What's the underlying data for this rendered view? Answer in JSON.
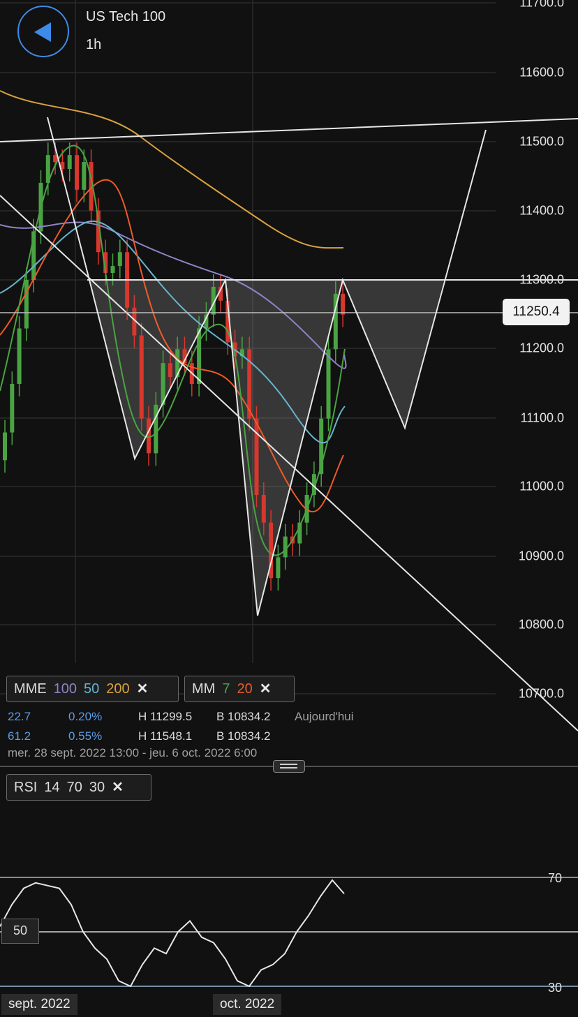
{
  "header": {
    "back_icon": "back-arrow-icon",
    "symbol": "US Tech 100",
    "timeframe": "1h"
  },
  "price_axis": {
    "labels": [
      "11700.0",
      "11600.0",
      "11500.0",
      "11400.0",
      "11300.0",
      "11200.0",
      "11100.0",
      "11000.0",
      "10900.0",
      "10800.0",
      "10700.0"
    ],
    "current_price": "11250.4"
  },
  "indicators": {
    "mme": {
      "label": "MME",
      "p1": "100",
      "p2": "50",
      "p3": "200",
      "close": "✕",
      "colors": {
        "p1": "#8f84c6",
        "p2": "#67b5cf",
        "p3": "#d9a23e"
      }
    },
    "mm": {
      "label": "MM",
      "p1": "7",
      "p2": "20",
      "close": "✕",
      "colors": {
        "p1": "#4aa343",
        "p2": "#ee5a2a"
      }
    },
    "rsi": {
      "label": "RSI",
      "p1": "14",
      "p2": "70",
      "p3": "30",
      "close": "✕"
    }
  },
  "stats": {
    "row1": {
      "a": "22.7",
      "b": "0.20%",
      "h": "H 11299.5",
      "l": "B 10834.2",
      "period": "Aujourd'hui"
    },
    "row2": {
      "a": "61.2",
      "b": "0.55%",
      "h": "H 11548.1",
      "l": "B 10834.2"
    },
    "range": "mer. 28 sept. 2022 13:00 - jeu. 6 oct. 2022 6:00"
  },
  "rsi_panel": {
    "upper": "70",
    "mid": "50",
    "lower": "30"
  },
  "time_axis": {
    "left": "sept. 2022",
    "center": "oct. 2022"
  },
  "chart_data": {
    "type": "candlestick",
    "y_range": [
      10700,
      11700
    ],
    "candle_colors": {
      "up": "#4aa343",
      "down": "#d8372d"
    },
    "closes": [
      11080,
      11150,
      11230,
      11300,
      11370,
      11440,
      11480,
      11470,
      11460,
      11480,
      11430,
      11470,
      11400,
      11340,
      11310,
      11320,
      11340,
      11260,
      11220,
      11100,
      11050,
      11120,
      11180,
      11160,
      11200,
      11180,
      11150,
      11230,
      11250,
      11290,
      11270,
      11210,
      11190,
      11200,
      11100,
      10990,
      10950,
      10870,
      10900,
      10930,
      10920,
      10950,
      10990,
      11020,
      11100,
      11200,
      11280,
      11250
    ],
    "rsi": [
      52,
      60,
      66,
      68,
      67,
      66,
      60,
      50,
      44,
      40,
      32,
      30,
      38,
      44,
      42,
      50,
      54,
      48,
      46,
      40,
      32,
      30,
      36,
      38,
      42,
      50,
      56,
      63,
      69,
      64
    ]
  }
}
